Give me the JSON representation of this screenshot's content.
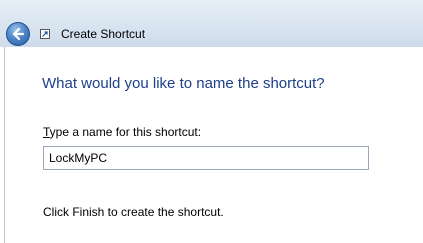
{
  "window": {
    "title": "Create Shortcut",
    "back_icon": "back-arrow-icon",
    "app_icon": "shortcut-icon"
  },
  "main": {
    "heading": "What would you like to name the shortcut?",
    "name_label_first": "T",
    "name_label_rest": "ype a name for this shortcut:",
    "name_value": "LockMyPC",
    "finish_text": "Click Finish to create the shortcut."
  },
  "colors": {
    "heading": "#1e3f8a",
    "titlebar": "#d9e4f1"
  }
}
